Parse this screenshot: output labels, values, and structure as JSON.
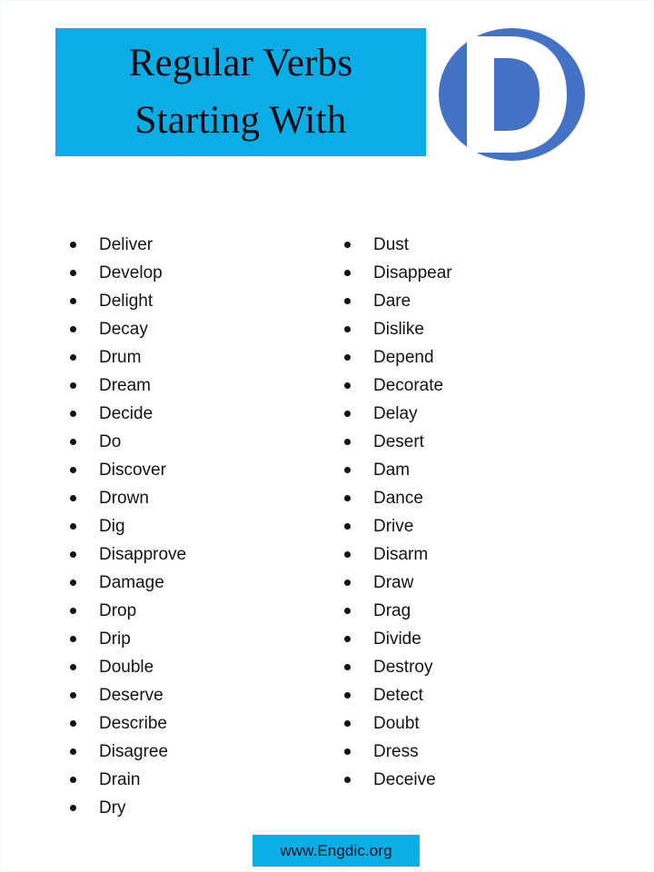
{
  "header": {
    "title_lines": [
      "Regular Verbs",
      "Starting With"
    ],
    "banner_color": "#0aaee4",
    "logo": {
      "letter": "D",
      "circle_color": "#4472c4",
      "letter_color": "#ffffff"
    }
  },
  "lists": {
    "left_column": [
      {
        "word": "Deliver"
      },
      {
        "word": "Develop"
      },
      {
        "word": "Delight"
      },
      {
        "word": "Decay"
      },
      {
        "word": "Drum"
      },
      {
        "word": "Dream"
      },
      {
        "word": "Decide"
      },
      {
        "word": "Do"
      },
      {
        "word": "Discover"
      },
      {
        "word": "Drown"
      },
      {
        "word": "Dig"
      },
      {
        "word": "Disapprove"
      },
      {
        "word": "Damage"
      },
      {
        "word": "Drop"
      },
      {
        "word": "Drip"
      },
      {
        "word": "Double"
      },
      {
        "word": "Deserve"
      },
      {
        "word": "Describe"
      },
      {
        "word": "Disagree"
      },
      {
        "word": "Drain"
      },
      {
        "word": "Dry"
      }
    ],
    "right_column": [
      {
        "word": "Dust"
      },
      {
        "word": "Disappear"
      },
      {
        "word": "Dare"
      },
      {
        "word": "Dislike"
      },
      {
        "word": "Depend"
      },
      {
        "word": "Decorate"
      },
      {
        "word": "Delay"
      },
      {
        "word": "Desert"
      },
      {
        "word": "Dam"
      },
      {
        "word": "Dance"
      },
      {
        "word": "Drive"
      },
      {
        "word": "Disarm"
      },
      {
        "word": "Draw"
      },
      {
        "word": "Drag"
      },
      {
        "word": "Divide"
      },
      {
        "word": "Destroy"
      },
      {
        "word": "Detect"
      },
      {
        "word": "Doubt"
      },
      {
        "word": "Dress"
      },
      {
        "word": "Deceive"
      }
    ]
  },
  "footer": {
    "site": "www.Engdic.org",
    "background_color": "#0aaee4"
  }
}
